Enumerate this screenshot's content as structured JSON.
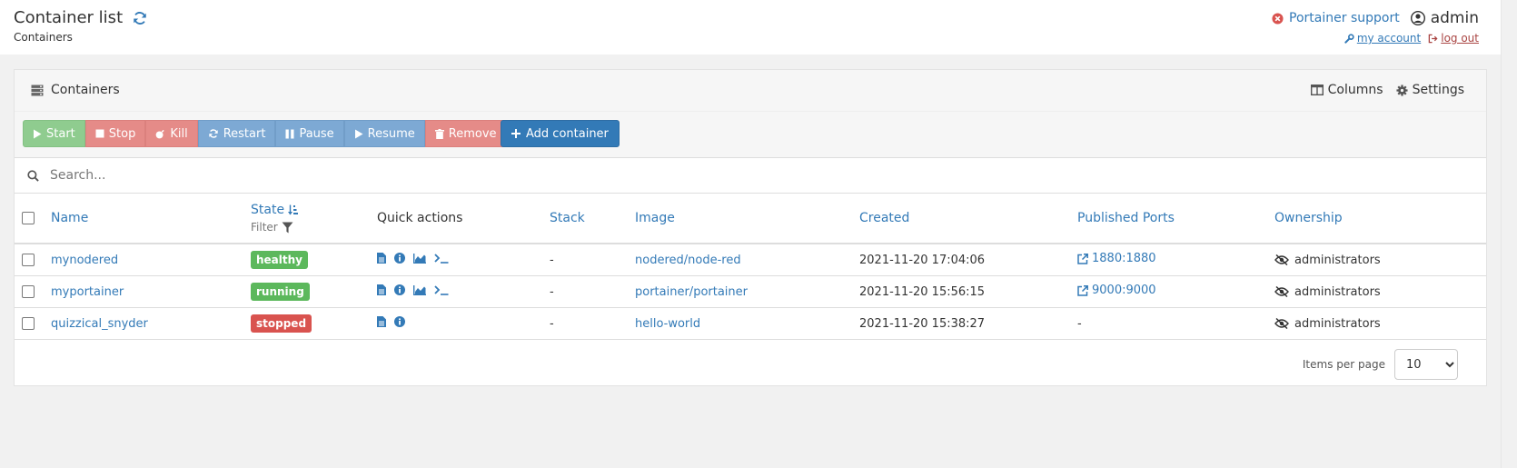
{
  "header": {
    "title": "Container list",
    "breadcrumb": "Containers",
    "support_label": "Portainer support",
    "username": "admin",
    "my_account_label": "my account",
    "logout_label": "log out"
  },
  "widget": {
    "title": "Containers",
    "columns_label": "Columns",
    "settings_label": "Settings"
  },
  "actions": {
    "start": "Start",
    "stop": "Stop",
    "kill": "Kill",
    "restart": "Restart",
    "pause": "Pause",
    "resume": "Resume",
    "remove": "Remove",
    "add_container": "Add container"
  },
  "search": {
    "placeholder": "Search..."
  },
  "table": {
    "headers": {
      "name": "Name",
      "state": "State",
      "filter": "Filter",
      "quick_actions": "Quick actions",
      "stack": "Stack",
      "image": "Image",
      "created": "Created",
      "published_ports": "Published Ports",
      "ownership": "Ownership"
    },
    "rows": [
      {
        "name": "mynodered",
        "state": "healthy",
        "stack": "-",
        "image": "nodered/node-red",
        "created": "2021-11-20 17:04:06",
        "ports": "1880:1880",
        "ownership": "administrators"
      },
      {
        "name": "myportainer",
        "state": "running",
        "stack": "-",
        "image": "portainer/portainer",
        "created": "2021-11-20 15:56:15",
        "ports": "9000:9000",
        "ownership": "administrators"
      },
      {
        "name": "quizzical_snyder",
        "state": "stopped",
        "stack": "-",
        "image": "hello-world",
        "created": "2021-11-20 15:38:27",
        "ports": "-",
        "ownership": "administrators"
      }
    ]
  },
  "footer": {
    "items_per_page_label": "Items per page",
    "items_per_page_value": "10"
  },
  "colors": {
    "link": "#337ab7",
    "success": "#5cb85c",
    "danger": "#d9534f"
  }
}
